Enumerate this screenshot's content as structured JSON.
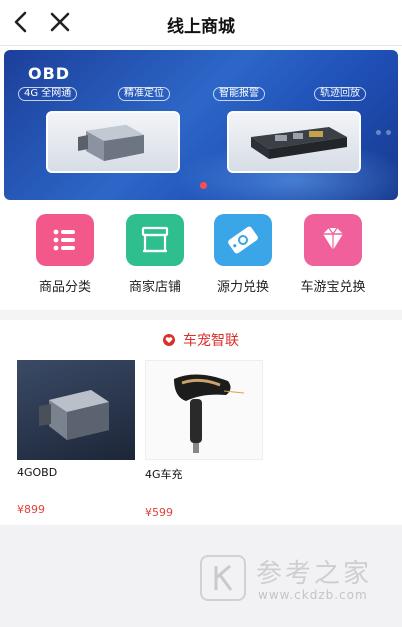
{
  "header": {
    "title": "线上商城",
    "back_icon": "chevron-left-icon",
    "close_icon": "close-icon"
  },
  "banner": {
    "brand": "OBD",
    "tags": [
      "4G 全网通",
      "精准定位",
      "智能报警",
      "轨迹回放"
    ],
    "active_slide": 1,
    "colors": {
      "background": "#2d67c8",
      "indicator": "#ff4d4f"
    }
  },
  "categories": [
    {
      "label": "商品分类",
      "icon": "list-icon",
      "color": "#f3588a"
    },
    {
      "label": "商家店铺",
      "icon": "store-icon",
      "color": "#2fbf8f"
    },
    {
      "label": "源力兑换",
      "icon": "ticket-icon",
      "color": "#3aa6e8"
    },
    {
      "label": "车游宝兑换",
      "icon": "diamond-icon",
      "color": "#f0609a"
    }
  ],
  "section": {
    "title": "车宠智联",
    "icon": "heart-icon",
    "color": "#d9302a"
  },
  "products": [
    {
      "name": "4GOBD",
      "price": "¥899"
    },
    {
      "name": "4G车充",
      "price": "¥599"
    }
  ],
  "watermark": {
    "text": "参考之家",
    "url": "www.ckdzb.com"
  }
}
